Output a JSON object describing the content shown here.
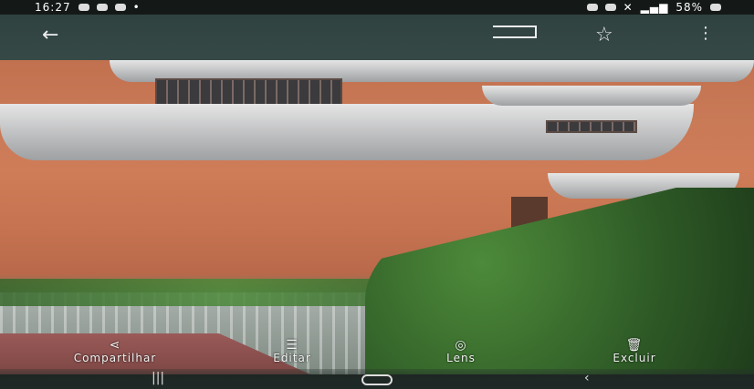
{
  "status_bar": {
    "time": "16:27",
    "battery": "58%"
  },
  "top_bar": {
    "back_icon": "arrow-left-icon",
    "cast_icon": "cast-icon",
    "favorite_icon": "star-outline-icon",
    "more_icon": "more-vert-icon"
  },
  "actions": [
    {
      "label": "Compartilhar",
      "icon": "share-icon"
    },
    {
      "label": "Editar",
      "icon": "sliders-icon"
    },
    {
      "label": "Lens",
      "icon": "lens-icon"
    },
    {
      "label": "Excluir",
      "icon": "trash-icon"
    }
  ],
  "colors": {
    "status_bg": "#141918",
    "top_bar": "#334644"
  }
}
